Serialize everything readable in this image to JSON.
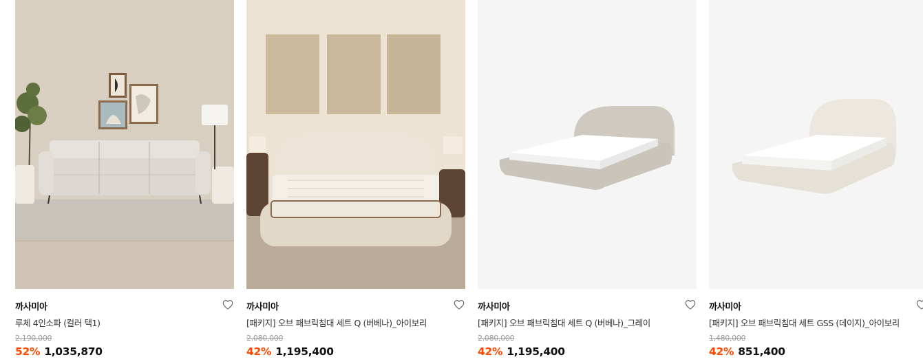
{
  "products": [
    {
      "brand": "까사미아",
      "title": "루체 4인소파 (컬러 택1)",
      "original_price": "2,190,000",
      "discount": "52%",
      "price": "1,035,870",
      "image": "sofa-living-room-photo"
    },
    {
      "brand": "까사미아",
      "title": "[패키지] 오브 패브릭침대 세트 Q (버베나)_아이보리",
      "original_price": "2,080,000",
      "discount": "42%",
      "price": "1,195,400",
      "image": "bed-ivory-room-photo"
    },
    {
      "brand": "까사미아",
      "title": "[패키지] 오브 패브릭침대 세트 Q (버베나)_그레이",
      "original_price": "2,080,000",
      "discount": "42%",
      "price": "1,195,400",
      "image": "bed-grey-product-photo"
    },
    {
      "brand": "까사미아",
      "title": "[패키지] 오브 패브릭침대 세트 GSS (데이지)_아이보리",
      "original_price": "1,480,000",
      "discount": "42%",
      "price": "851,400",
      "image": "bed-ivory-product-photo"
    }
  ],
  "colors": {
    "discount": "#ff4800",
    "strike": "#9a9a9a",
    "brand": "#111111"
  }
}
